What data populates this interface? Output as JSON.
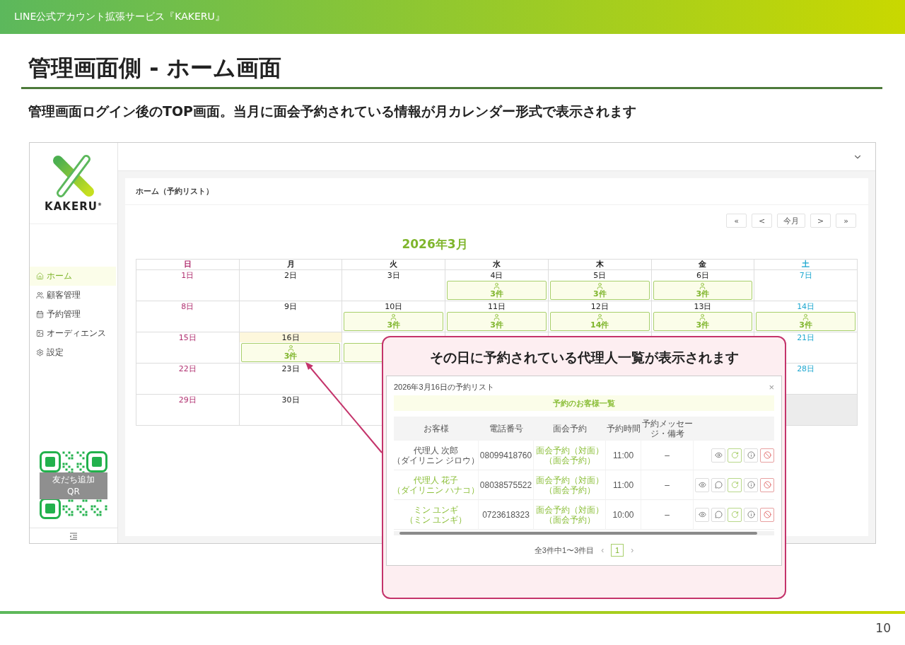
{
  "slide": {
    "header": "LINE公式アカウント拡張サービス『KAKERU』",
    "title": "管理画面側 - ホーム画面",
    "subtitle": "管理画面ログイン後のTOP画面。当月に面会予約されている情報が月カレンダー形式で表示されます",
    "page_number": "10"
  },
  "app": {
    "sidebar": {
      "logo": "KAKERU$^{®}$",
      "items": [
        {
          "label": "ホーム",
          "kind": "home",
          "selected": true
        },
        {
          "label": "顧客管理",
          "kind": "customers",
          "selected": false
        },
        {
          "label": "予約管理",
          "kind": "calendar",
          "selected": false
        },
        {
          "label": "オーディエンス",
          "kind": "audience",
          "selected": false
        },
        {
          "label": "設定",
          "kind": "settings",
          "selected": false
        }
      ],
      "qr_label": "友だち追加\nQR"
    },
    "card_title": "ホーム（予約リスト）",
    "nav_buttons": [
      "«",
      "<",
      "今月",
      ">",
      "»"
    ],
    "month": "2026年3月",
    "weekdays": [
      {
        "label": "日",
        "kind": "sunday"
      },
      {
        "label": "月",
        "kind": "weekday"
      },
      {
        "label": "火",
        "kind": "weekday"
      },
      {
        "label": "水",
        "kind": "weekday"
      },
      {
        "label": "木",
        "kind": "weekday"
      },
      {
        "label": "金",
        "kind": "weekday"
      },
      {
        "label": "土",
        "kind": "saturday"
      }
    ],
    "weeks": [
      {
        "cells": [
          {
            "date": "1日",
            "today": false
          },
          {
            "date": "2日",
            "today": false
          },
          {
            "date": "3日",
            "today": false
          },
          {
            "date": "4日",
            "count": "3件",
            "today": false
          },
          {
            "date": "5日",
            "count": "3件",
            "today": false
          },
          {
            "date": "6日",
            "count": "3件",
            "today": false
          },
          {
            "date": "7日",
            "today": false
          }
        ]
      },
      {
        "cells": [
          {
            "date": "8日",
            "today": false
          },
          {
            "date": "9日",
            "today": false
          },
          {
            "date": "10日",
            "count": "3件",
            "today": false
          },
          {
            "date": "11日",
            "count": "3件",
            "today": false
          },
          {
            "date": "12日",
            "count": "14件",
            "today": false
          },
          {
            "date": "13日",
            "count": "3件",
            "today": false
          },
          {
            "date": "14日",
            "count": "3件",
            "today": false
          }
        ]
      },
      {
        "cells": [
          {
            "date": "15日",
            "today": false
          },
          {
            "date": "16日",
            "count": "3件",
            "today": true
          },
          {
            "booked": true,
            "today": false
          }
        ],
        "end_cells": [
          {
            "date": "21日",
            "today": false
          }
        ]
      },
      {
        "cells": [
          {
            "date": "22日",
            "today": false
          },
          {
            "date": "23日",
            "today": false
          },
          {
            "today": false
          }
        ],
        "end_cells": [
          {
            "date": "28日",
            "today": false
          }
        ]
      },
      {
        "cells": [
          {
            "date": "29日",
            "today": false
          },
          {
            "date": "30日",
            "today": false
          },
          {
            "today": false
          }
        ],
        "end_cells": [
          {
            "outside": true
          }
        ]
      }
    ]
  },
  "callout": {
    "text": "その日に予約されている代理人一覧が表示されます",
    "modal": {
      "title": "2026年3月16日の予約リスト",
      "close": "×",
      "banner": "予約のお客様一覧",
      "columns": [
        "お客様",
        "電話番号",
        "面会予約",
        "予約時間",
        "予約メッセージ・備考"
      ],
      "rows": [
        {
          "kind": "guest",
          "name": "代理人 次郎",
          "reading": "（ダイリニン ジロウ）",
          "phone": "08099418760",
          "type": "面会予約（対面）",
          "type_note": "（面会予約）",
          "time": "11:00",
          "message": "–",
          "actions": [
            {
              "kind": "view"
            },
            {
              "kind": "reschedule"
            },
            {
              "kind": "info"
            },
            {
              "kind": "cancel"
            }
          ]
        },
        {
          "kind": "line",
          "name": "代理人 花子",
          "reading": "（ダイリニン ハナコ）",
          "phone": "08038575522",
          "type": "面会予約（対面）",
          "type_note": "（面会予約）",
          "time": "11:00",
          "message": "–",
          "actions": [
            {
              "kind": "view"
            },
            {
              "kind": "chat"
            },
            {
              "kind": "reschedule"
            },
            {
              "kind": "info"
            },
            {
              "kind": "cancel"
            }
          ]
        },
        {
          "kind": "line",
          "name": "ミン ユンギ",
          "reading": "（ミン ユンギ）",
          "phone": "0723618323",
          "type": "面会予約（対面）",
          "type_note": "（面会予約）",
          "time": "10:00",
          "message": "–",
          "actions": [
            {
              "kind": "view"
            },
            {
              "kind": "chat"
            },
            {
              "kind": "reschedule"
            },
            {
              "kind": "info"
            },
            {
              "kind": "cancel"
            }
          ]
        }
      ],
      "summary": "全3件中1〜3件目",
      "pages": [
        {
          "label": "1",
          "selected": true
        }
      ],
      "prev": "‹",
      "next": "›"
    }
  }
}
